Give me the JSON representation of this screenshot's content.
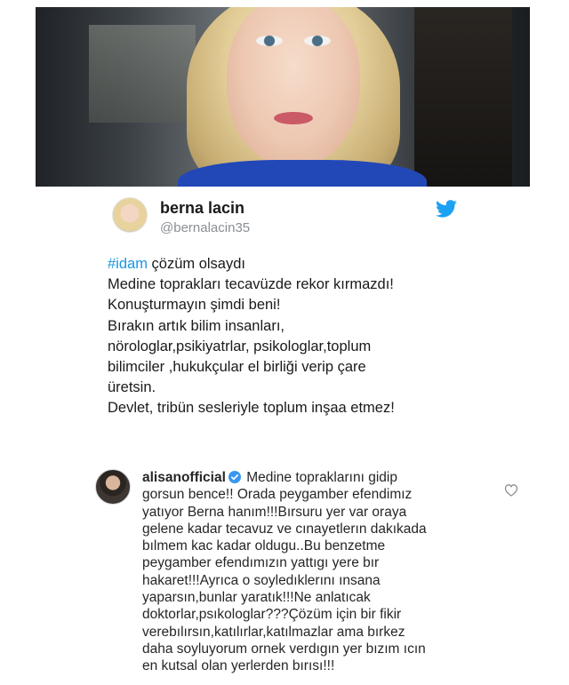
{
  "tweet": {
    "name": "berna lacin",
    "handle": "@bernalacin35",
    "hashtag": "#idam",
    "first_line_rest": " çözüm olsaydı",
    "lines": [
      "Medine toprakları tecavüzde rekor kırmazdı!",
      "Konuşturmayın şimdi beni!",
      "Bırakın artık bilim insanları,",
      "nörologlar,psikiyatrlar, psikologlar,toplum",
      "bilimciler ,hukukçular el birliği verip çare",
      "üretsin.",
      "Devlet, tribün sesleriyle toplum inşaa etmez!"
    ]
  },
  "comment": {
    "username": "alisanofficial",
    "first_line_rest": " Medine topraklarını gidip",
    "lines": [
      "gorsun bence!! Orada peygamber efendimız",
      "yatıyor Berna hanım!!!Bırsuru yer var oraya",
      "gelene kadar tecavuz ve cınayetlerın dakıkada",
      "bılmem kac kadar oldugu..Bu benzetme",
      "peygamber efendımızın yattıgı yere bır",
      "hakaret!!!Ayrıca o soyledıklerını ınsana",
      "yaparsın,bunlar yaratık!!!Ne anlatıcak",
      "doktorlar,psıkologlar???Çözüm için bir fikir",
      "verebılırsın,katılırlar,katılmazlar ama bırkez",
      "daha soyluyorum ornek verdıgın yer bızım ıcın",
      "en kutsal olan yerlerden bırısı!!!"
    ]
  },
  "icons": {
    "twitter": "twitter-bird-icon",
    "verified": "verified-badge-icon",
    "heart": "heart-icon"
  },
  "colors": {
    "hashtag": "#1b95e0",
    "twitter_blue": "#1da1f2",
    "verified_blue": "#3897f0",
    "handle_gray": "#8a8f94"
  }
}
